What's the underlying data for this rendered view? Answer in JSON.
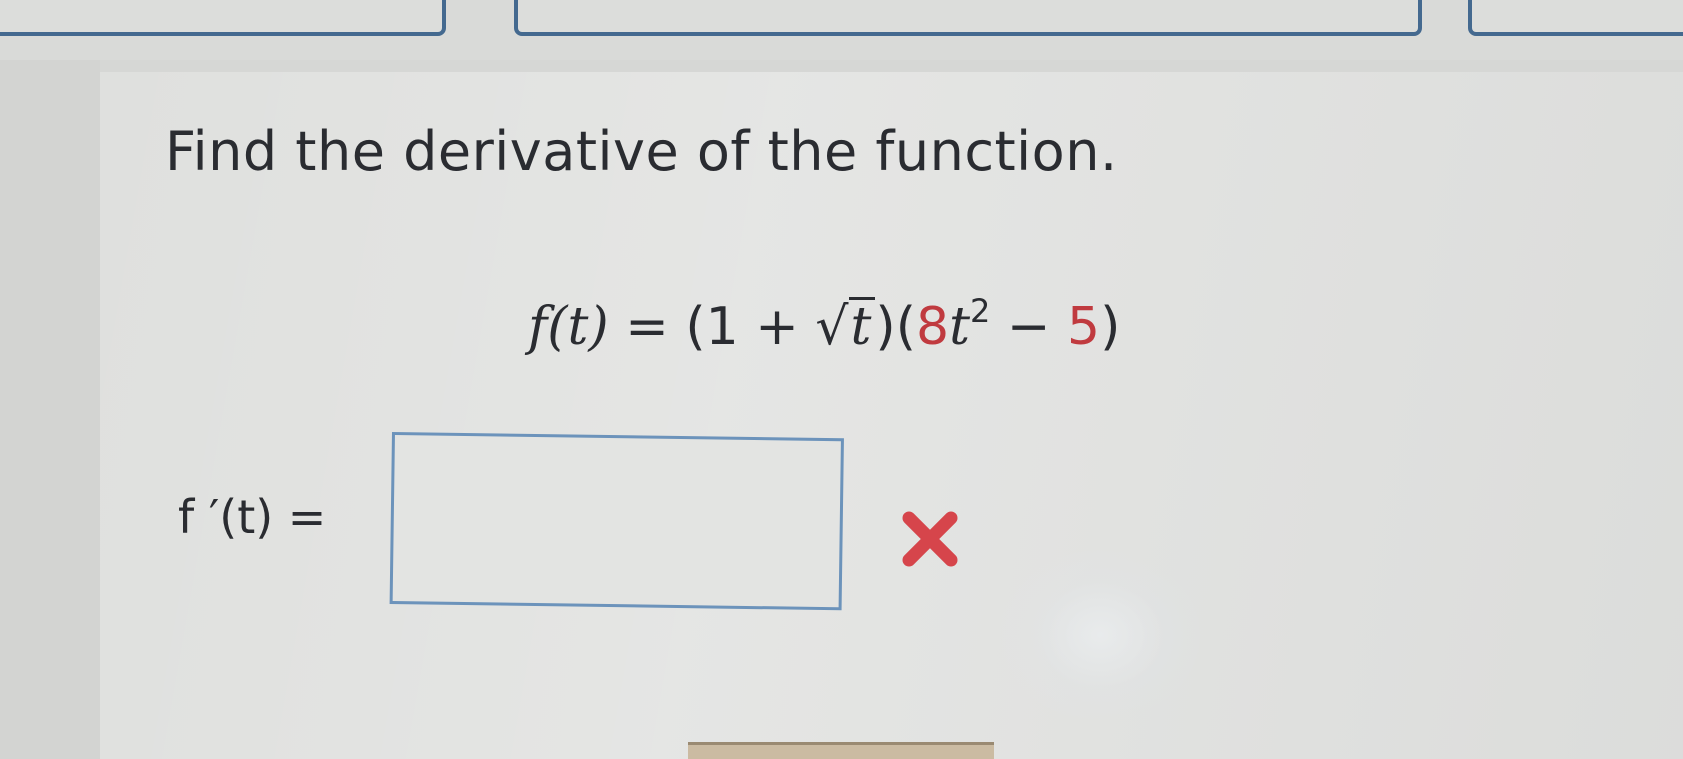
{
  "question": {
    "prompt": "Find the derivative of the function."
  },
  "function": {
    "lhs": "f(t)",
    "equals": "=",
    "open_paren": "(1 +",
    "radical": "√",
    "radicand": "t",
    "factor_open": ")(",
    "coefficient": "8",
    "variable": "t",
    "exponent": "2",
    "minus": "−",
    "constant": "5",
    "close_paren": ")"
  },
  "answer": {
    "label": "f ′(t) =",
    "value": "",
    "status": "incorrect"
  },
  "icons": {
    "status_icon": "close-icon",
    "status_color": "#d6454b"
  },
  "colors": {
    "box_border": "#6c93bb",
    "tab_border": "#44698f",
    "highlight": "#c03a3f"
  }
}
